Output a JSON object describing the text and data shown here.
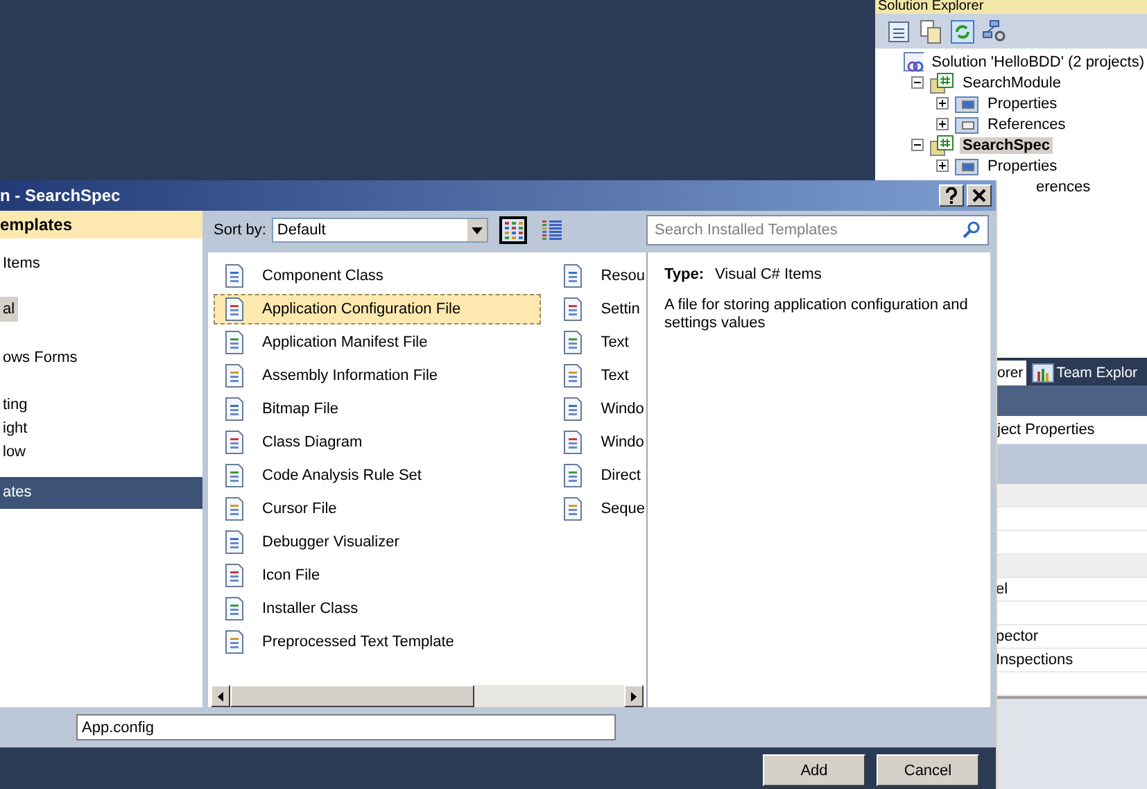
{
  "solution_explorer": {
    "title": "Solution Explorer",
    "tree": [
      {
        "label": "Solution 'HelloBDD' (2 projects)",
        "kind": "solution",
        "selected": false,
        "children": [
          {
            "label": "SearchModule",
            "kind": "project",
            "expanded": true,
            "selected": false,
            "children": [
              {
                "label": "Properties",
                "kind": "properties",
                "expanded": false,
                "selected": false
              },
              {
                "label": "References",
                "kind": "references",
                "expanded": false,
                "selected": false
              }
            ]
          },
          {
            "label": "SearchSpec",
            "kind": "project",
            "expanded": true,
            "selected": true,
            "children": [
              {
                "label": "Properties",
                "kind": "properties",
                "expanded": false,
                "selected": false
              },
              {
                "label": "erences",
                "kind": "clipped",
                "selected": false
              }
            ]
          }
        ]
      }
    ]
  },
  "properties_panel": {
    "tabs": [
      {
        "label": "orer",
        "selected": true
      },
      {
        "label": "Team Explor",
        "selected": false
      }
    ],
    "object": "ject Properties",
    "rows": [
      {
        "label": "el"
      },
      {
        "label": "pector"
      },
      {
        "label": "Inspections"
      }
    ]
  },
  "dialog": {
    "title": "n - SearchSpec",
    "categories": {
      "header": "emplates",
      "items": [
        {
          "label": "Items",
          "selected": false,
          "highlighted": false
        },
        {
          "label": "al",
          "selected": false,
          "highlighted": true
        },
        {
          "label": "ows Forms",
          "selected": false,
          "highlighted": false
        },
        {
          "label": "ting",
          "selected": false,
          "highlighted": false
        },
        {
          "label": "ight",
          "selected": false,
          "highlighted": false
        },
        {
          "label": "low",
          "selected": false,
          "highlighted": false
        },
        {
          "label": "ates",
          "selected": true,
          "highlighted": false
        }
      ]
    },
    "sort_label": "Sort by:",
    "sort_value": "Default",
    "view_modes": [
      {
        "selected": true
      },
      {
        "selected": false
      }
    ],
    "search": {
      "placeholder": "Search Installed Templates"
    },
    "templates": [
      {
        "label": "Component Class",
        "selected": false
      },
      {
        "label": "Application Configuration File",
        "selected": true
      },
      {
        "label": "Application Manifest File",
        "selected": false
      },
      {
        "label": "Assembly Information File",
        "selected": false
      },
      {
        "label": "Bitmap File",
        "selected": false
      },
      {
        "label": "Class Diagram",
        "selected": false
      },
      {
        "label": "Code Analysis Rule Set",
        "selected": false
      },
      {
        "label": "Cursor File",
        "selected": false
      },
      {
        "label": "Debugger Visualizer",
        "selected": false
      },
      {
        "label": "Icon File",
        "selected": false
      },
      {
        "label": "Installer Class",
        "selected": false
      },
      {
        "label": "Preprocessed Text Template",
        "selected": false
      },
      {
        "label": "Resou",
        "selected": false
      },
      {
        "label": "Settin",
        "selected": false
      },
      {
        "label": "Text",
        "selected": false
      },
      {
        "label": "Text",
        "selected": false
      },
      {
        "label": "Windo",
        "selected": false
      },
      {
        "label": "Windo",
        "selected": false
      },
      {
        "label": "Direct",
        "selected": false
      },
      {
        "label": "Seque",
        "selected": false
      }
    ],
    "details": {
      "type_label": "Type:",
      "type_value": "Visual C# Items",
      "description": "A file for storing application configuration and settings values"
    },
    "file_name": "App.config",
    "buttons": [
      "Add",
      "Cancel"
    ]
  }
}
